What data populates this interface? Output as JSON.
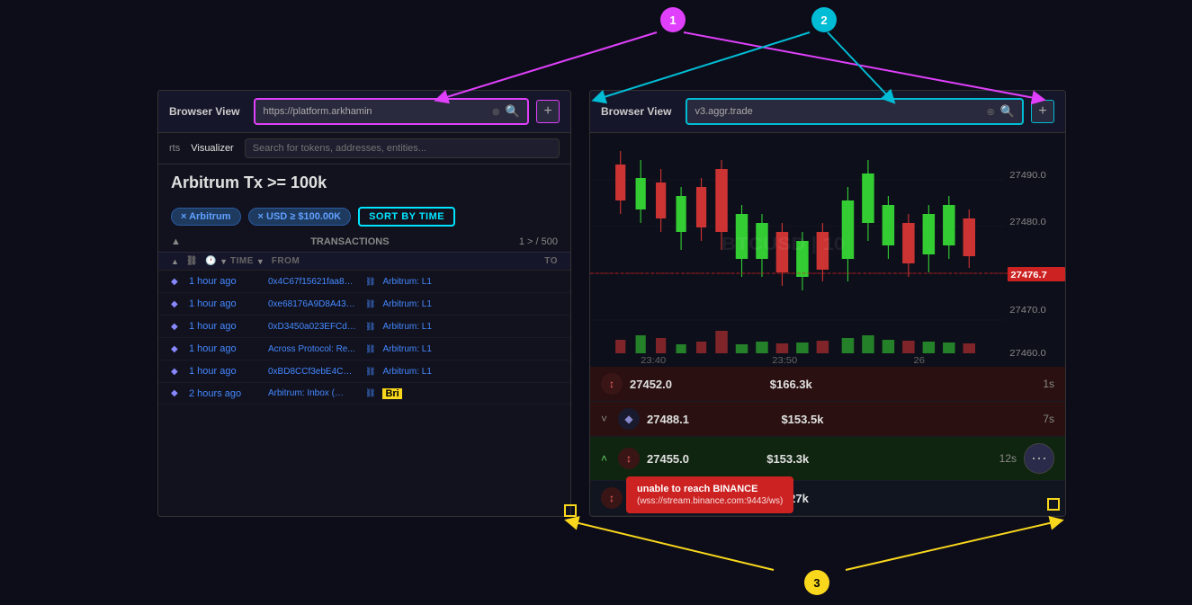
{
  "annotations": {
    "circle1": {
      "label": "1",
      "type": "pink"
    },
    "circle2": {
      "label": "2",
      "type": "cyan"
    },
    "circle3": {
      "label": "3",
      "type": "yellow"
    }
  },
  "leftBrowser": {
    "title": "Browser View",
    "url": "https://platform.arkhamin",
    "newTabLabel": "+"
  },
  "rightBrowser": {
    "title": "Browser View",
    "url": "v3.aggr.trade",
    "newTabLabel": "+"
  },
  "leftApp": {
    "navItems": [
      "rts",
      "Visualizer"
    ],
    "searchPlaceholder": "Search for tokens, addresses, entities...",
    "pageTitle": "Arbitrum Tx >= 100k",
    "filters": {
      "arbitrum": "× Arbitrum",
      "usd": "× USD ≥ $100.00K",
      "sortBtn": "SORT BY TIME"
    },
    "transactions": {
      "label": "TRANSACTIONS",
      "count": "1 > / 500"
    },
    "colHeaders": [
      "▲",
      "⛓",
      "🕐",
      "▼",
      "TIME",
      "▼",
      "FROM",
      "TO"
    ],
    "rows": [
      {
        "time": "1 hour ago",
        "from": "0x4C67f15621faa854324...",
        "to": "Arbitrum: L1"
      },
      {
        "time": "1 hour ago",
        "from": "0xe68176A9D8A4323Ea3F...",
        "to": "Arbitrum: L1"
      },
      {
        "time": "1 hour ago",
        "from": "0xD3450a023EFCd10c28b...",
        "to": "Arbitrum: L1"
      },
      {
        "time": "1 hour ago",
        "from": "Across Protocol: Re...",
        "to": "Arbitrum: L1"
      },
      {
        "time": "1 hour ago",
        "from": "0xBD8CCf3ebE4CC2D5796...",
        "to": "Arbitrum: L1"
      },
      {
        "time": "2 hours ago",
        "from": "Arbitrum: Inbox (…",
        "to": "Bri"
      }
    ]
  },
  "rightApp": {
    "chartLabel": "BTCUSD | 10",
    "timeLabels": [
      "23:40",
      "23:50",
      "26"
    ],
    "priceLabels": [
      "27490.0",
      "27480.0",
      "27476.7",
      "27470.0",
      "27460.0"
    ],
    "currentPrice": "27476.7",
    "trades": [
      {
        "direction": "sell",
        "price": "27452.0",
        "usd": "$166.3k",
        "time": "1s"
      },
      {
        "direction": "buy",
        "price": "27488.1",
        "usd": "$153.5k",
        "time": "7s"
      },
      {
        "direction": "sell",
        "price": "27455.0",
        "usd": "$153.3k",
        "time": "12s"
      },
      {
        "direction": "sell",
        "price": "",
        "usd": "$127k",
        "time": ""
      }
    ],
    "errorToast": {
      "title": "unable to reach BINANCE",
      "url": "(wss://stream.binance.com:9443/ws)"
    },
    "moreBtn": "⋯"
  }
}
